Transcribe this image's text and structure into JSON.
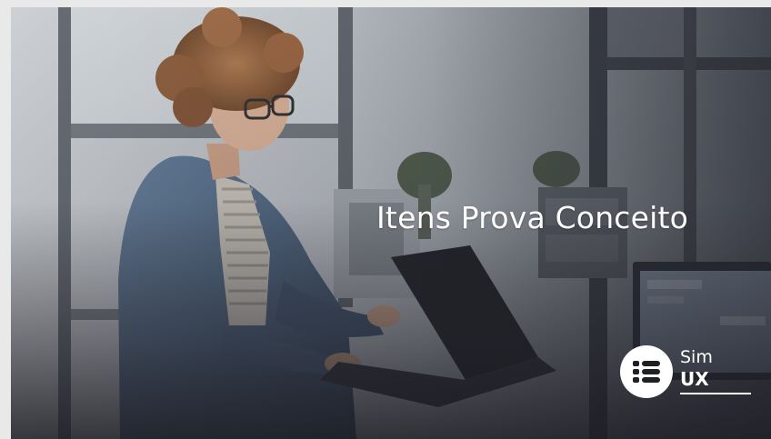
{
  "banner": {
    "title": "Itens Prova Conceito",
    "background_image": "woman-with-glasses-using-laptop-in-office"
  },
  "logo": {
    "icon": "list-icon",
    "line1": "Sim",
    "line2": "UX"
  },
  "colors": {
    "text": "#ffffff",
    "overlay": "#2a2a32",
    "page_background": "#e9e9e9"
  }
}
